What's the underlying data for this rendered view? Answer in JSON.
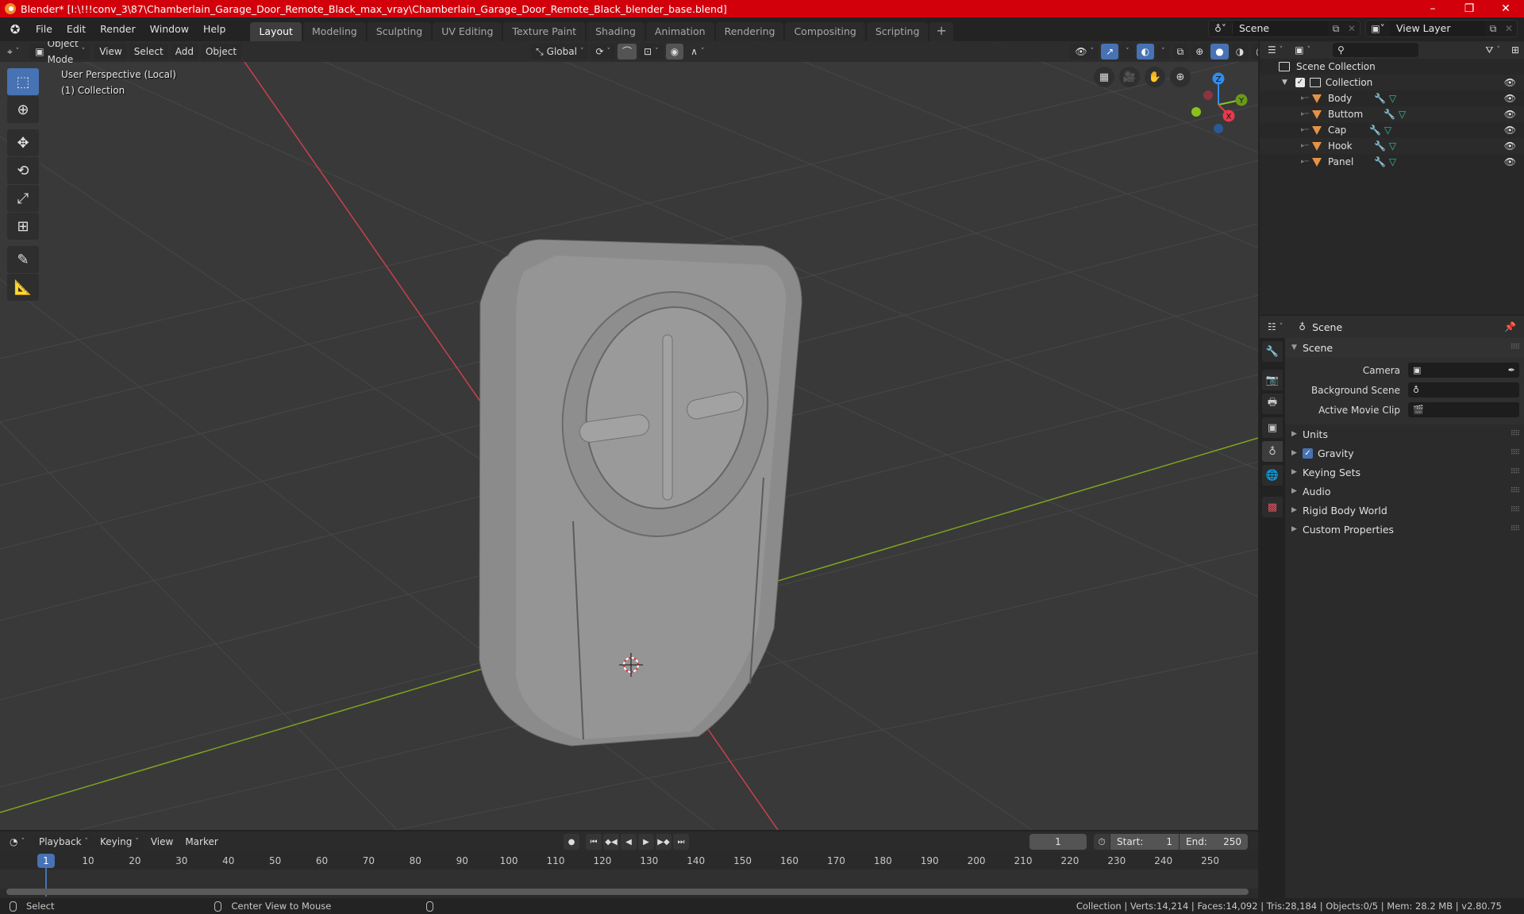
{
  "window": {
    "title": "Blender* [I:\\!!!conv_3\\87\\Chamberlain_Garage_Door_Remote_Black_max_vray\\Chamberlain_Garage_Door_Remote_Black_blender_base.blend]",
    "controls": {
      "minimize": "–",
      "maximize": "❐",
      "close": "✕"
    }
  },
  "menu": {
    "items": [
      "File",
      "Edit",
      "Render",
      "Window",
      "Help"
    ]
  },
  "workspaces": {
    "tabs": [
      "Layout",
      "Modeling",
      "Sculpting",
      "UV Editing",
      "Texture Paint",
      "Shading",
      "Animation",
      "Rendering",
      "Compositing",
      "Scripting"
    ],
    "active": "Layout",
    "add_label": "+"
  },
  "scene_selector": {
    "value": "Scene",
    "icon": "scene-icon"
  },
  "view_layer_selector": {
    "value": "View Layer",
    "icon": "render-layers-icon"
  },
  "viewport": {
    "header": {
      "editor_type_icon": "3d-viewport-icon",
      "mode": "Object Mode",
      "menus": [
        "View",
        "Select",
        "Add",
        "Object"
      ],
      "transform_orientation": "Global"
    },
    "overlay_text": {
      "line1": "User Perspective (Local)",
      "line2": "(1) Collection"
    },
    "tools": [
      "select-box",
      "cursor",
      "move",
      "rotate",
      "scale",
      "transform",
      "annotate",
      "measure"
    ],
    "active_tool": "select-box",
    "nav_buttons": [
      "toggle-grid-view",
      "camera-view",
      "pan",
      "zoom"
    ],
    "gizmo_axes": [
      "X",
      "Y",
      "Z"
    ],
    "colors": {
      "x_axis": "#e8394d",
      "y_axis": "#8ac621",
      "z_axis": "#2f8cf0",
      "bg": "#393939",
      "model": "#8d8d8d"
    }
  },
  "outliner": {
    "search_placeholder": "",
    "root": "Scene Collection",
    "collection": "Collection",
    "objects": [
      {
        "name": "Body"
      },
      {
        "name": "Buttom"
      },
      {
        "name": "Cap"
      },
      {
        "name": "Hook"
      },
      {
        "name": "Panel"
      }
    ]
  },
  "properties": {
    "context": "Scene",
    "panel_title": "Scene",
    "fields": [
      {
        "label": "Camera",
        "value": ""
      },
      {
        "label": "Background Scene",
        "value": ""
      },
      {
        "label": "Active Movie Clip",
        "value": ""
      }
    ],
    "subpanels": [
      {
        "label": "Units",
        "checkbox": false
      },
      {
        "label": "Gravity",
        "checkbox": true,
        "checked": true
      },
      {
        "label": "Keying Sets",
        "checkbox": false
      },
      {
        "label": "Audio",
        "checkbox": false
      },
      {
        "label": "Rigid Body World",
        "checkbox": false
      },
      {
        "label": "Custom Properties",
        "checkbox": false
      }
    ],
    "tabs": [
      "tool",
      "render",
      "output",
      "view-layer",
      "scene",
      "world",
      "texture"
    ],
    "active_tab": "scene"
  },
  "timeline": {
    "menus": [
      "Playback",
      "Keying",
      "View",
      "Marker"
    ],
    "current_frame": "1",
    "start_label": "Start:",
    "start": "1",
    "end_label": "End:",
    "end": "250",
    "ruler_ticks": [
      "10",
      "20",
      "30",
      "40",
      "50",
      "60",
      "70",
      "80",
      "90",
      "100",
      "110",
      "120",
      "130",
      "140",
      "150",
      "160",
      "170",
      "180",
      "190",
      "200",
      "210",
      "220",
      "230",
      "240",
      "250"
    ],
    "current_marker": "1"
  },
  "statusbar": {
    "left_hint": "Select",
    "middle_hint": "Center View to Mouse",
    "stats": "Collection | Verts:14,214 | Faces:14,092 | Tris:28,184 | Objects:0/5 | Mem: 28.2 MB | v2.80.75"
  }
}
